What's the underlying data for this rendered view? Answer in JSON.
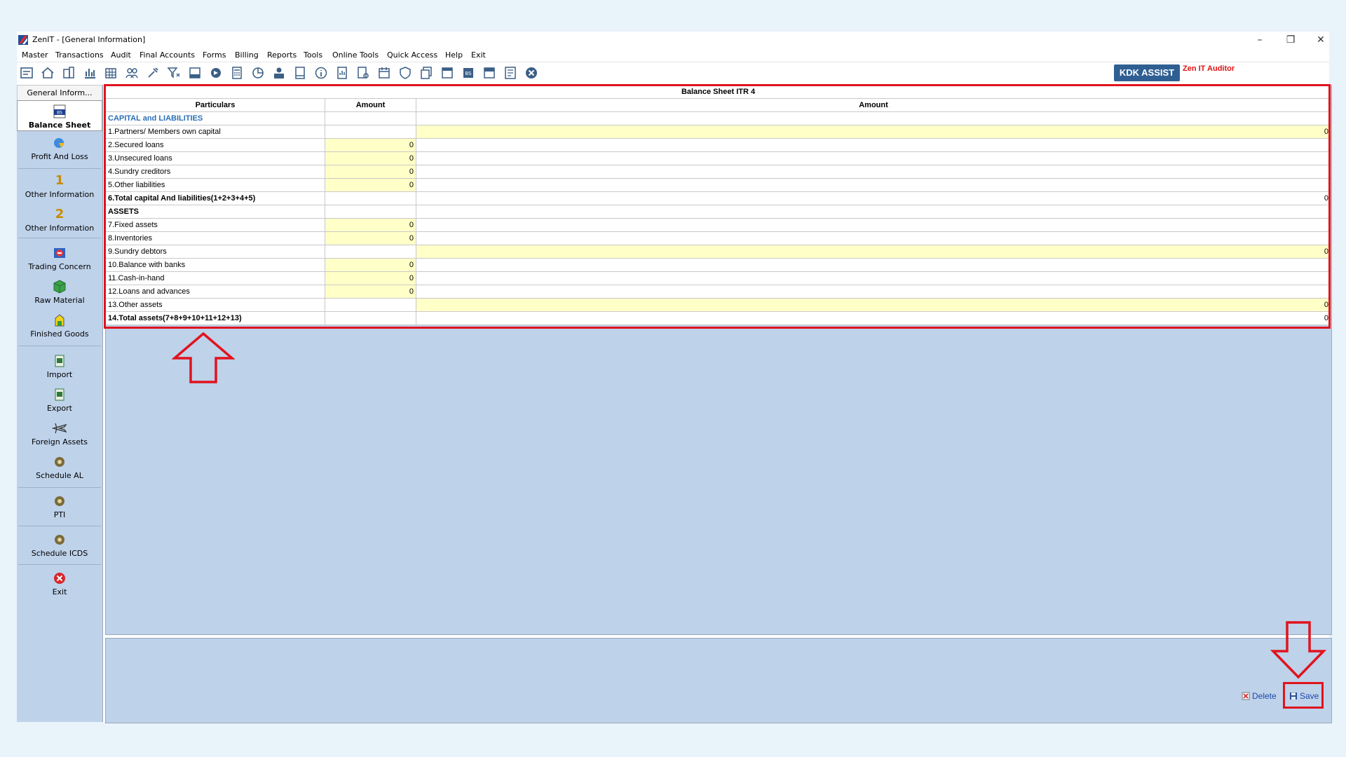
{
  "window": {
    "title": "ZenIT - [General Information]",
    "minimize_glyph": "–",
    "restore_glyph": "❐",
    "close_glyph": "✕"
  },
  "menu": [
    "Master",
    "Transactions",
    "Audit",
    "Final Accounts",
    "Forms",
    "Billing",
    "Reports",
    "Tools",
    "Online Tools",
    "Quick Access",
    "Help",
    "Exit"
  ],
  "toolbar": {
    "kdk_label": "KDK ASSIST",
    "zen_label": "Zen IT Auditor"
  },
  "sidebar": {
    "tab_label": "General Inform...",
    "items": [
      {
        "label": "Balance Sheet",
        "icon": "balance-sheet-icon"
      },
      {
        "label": "Profit And Loss",
        "icon": "profit-loss-icon"
      },
      {
        "label": "Other Information",
        "icon": "number-one-icon",
        "glyph": "1"
      },
      {
        "label": "Other Information",
        "icon": "number-two-icon",
        "glyph": "2"
      },
      {
        "label": "Trading Concern",
        "icon": "trading-icon"
      },
      {
        "label": "Raw Material",
        "icon": "raw-material-icon"
      },
      {
        "label": "Finished Goods",
        "icon": "finished-goods-icon"
      },
      {
        "label": "Import",
        "icon": "import-icon"
      },
      {
        "label": "Export",
        "icon": "export-icon"
      },
      {
        "label": "Foreign Assets",
        "icon": "airplane-icon"
      },
      {
        "label": "Schedule AL",
        "icon": "schedule-icon"
      },
      {
        "label": "PTI",
        "icon": "schedule-icon"
      },
      {
        "label": "Schedule ICDS",
        "icon": "schedule-icon"
      },
      {
        "label": "Exit",
        "icon": "exit-icon"
      }
    ]
  },
  "grid": {
    "caption": "Balance Sheet ITR 4",
    "headers": [
      "Particulars",
      "Amount",
      "Amount"
    ],
    "rows": [
      {
        "particular": "CAPITAL and LIABILITIES",
        "a1": "",
        "a2": ""
      },
      {
        "particular": "1.Partners/ Members own capital",
        "a1": "",
        "a2": "0"
      },
      {
        "particular": "2.Secured loans",
        "a1": "0",
        "a2": ""
      },
      {
        "particular": "3.Unsecured loans",
        "a1": "0",
        "a2": ""
      },
      {
        "particular": "4.Sundry creditors",
        "a1": "0",
        "a2": ""
      },
      {
        "particular": "5.Other liabilities",
        "a1": "0",
        "a2": ""
      },
      {
        "particular": "6.Total capital And liabilities(1+2+3+4+5)",
        "a1": "",
        "a2": "0"
      },
      {
        "particular": "ASSETS",
        "a1": "",
        "a2": ""
      },
      {
        "particular": "7.Fixed assets",
        "a1": "0",
        "a2": ""
      },
      {
        "particular": "8.Inventories",
        "a1": "0",
        "a2": ""
      },
      {
        "particular": "9.Sundry debtors",
        "a1": "",
        "a2": "0"
      },
      {
        "particular": "10.Balance with banks",
        "a1": "0",
        "a2": ""
      },
      {
        "particular": "11.Cash-in-hand",
        "a1": "0",
        "a2": ""
      },
      {
        "particular": "12.Loans and advances",
        "a1": "0",
        "a2": ""
      },
      {
        "particular": "13.Other assets",
        "a1": "",
        "a2": "0"
      },
      {
        "particular": "14.Total assets(7+8+9+10+11+12+13)",
        "a1": "",
        "a2": "0"
      }
    ]
  },
  "actions": {
    "delete_label": "Delete",
    "save_label": "Save"
  },
  "colors": {
    "highlight": "#e1131d",
    "input_yellow": "#ffffc8",
    "panel_blue": "#bed2ea"
  }
}
